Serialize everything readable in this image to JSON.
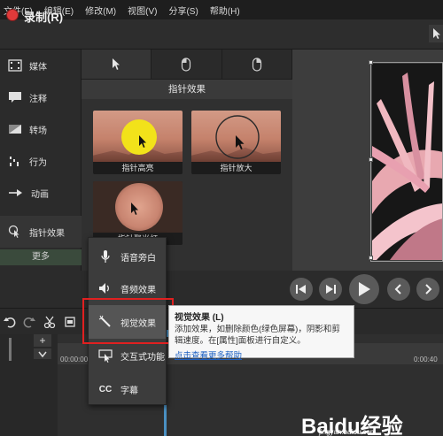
{
  "menubar": [
    "文件(F)",
    "编辑(E)",
    "修改(M)",
    "视图(V)",
    "分享(S)",
    "帮助(H)"
  ],
  "record": {
    "label": "录制(R)"
  },
  "sidebar": {
    "items": [
      {
        "label": "媒体",
        "icon": "film-strip-icon"
      },
      {
        "label": "注释",
        "icon": "annotation-icon"
      },
      {
        "label": "转场",
        "icon": "transition-icon"
      },
      {
        "label": "行为",
        "icon": "behavior-icon"
      },
      {
        "label": "动画",
        "icon": "animation-icon"
      },
      {
        "label": "指针效果",
        "icon": "cursor-effect-icon"
      }
    ],
    "more": "更多"
  },
  "panel": {
    "title": "指针效果",
    "tabs": [
      "pointer-icon",
      "mouse-left-click-icon",
      "mouse-right-click-icon"
    ],
    "thumbs": [
      "指针高亮",
      "指针放大",
      "指针聚光灯"
    ]
  },
  "dropdown": {
    "items": [
      {
        "label": "语音旁白",
        "icon": "microphone-icon"
      },
      {
        "label": "音频效果",
        "icon": "speaker-icon"
      },
      {
        "label": "视觉效果",
        "icon": "magic-wand-icon"
      },
      {
        "label": "交互式功能",
        "icon": "interactive-icon"
      },
      {
        "label": "字幕",
        "icon": "cc-icon"
      }
    ]
  },
  "tooltip": {
    "title": "视觉效果 (L)",
    "body": "添加效果，如删除颜色(绿色屏幕)，阴影和剪辑速度。在[属性]面板进行自定义。",
    "link": "点击查看更多帮助"
  },
  "timeline": {
    "ticks": [
      "00:00:00;00",
      "0:00:40"
    ]
  },
  "watermark": {
    "text": "Baidu经验",
    "url": "jingyan.baidu.com"
  },
  "colors": {
    "record": "#e03a3a",
    "highlight": "#e02020",
    "link": "#1a5fc2",
    "playhead": "#4a90c2"
  }
}
